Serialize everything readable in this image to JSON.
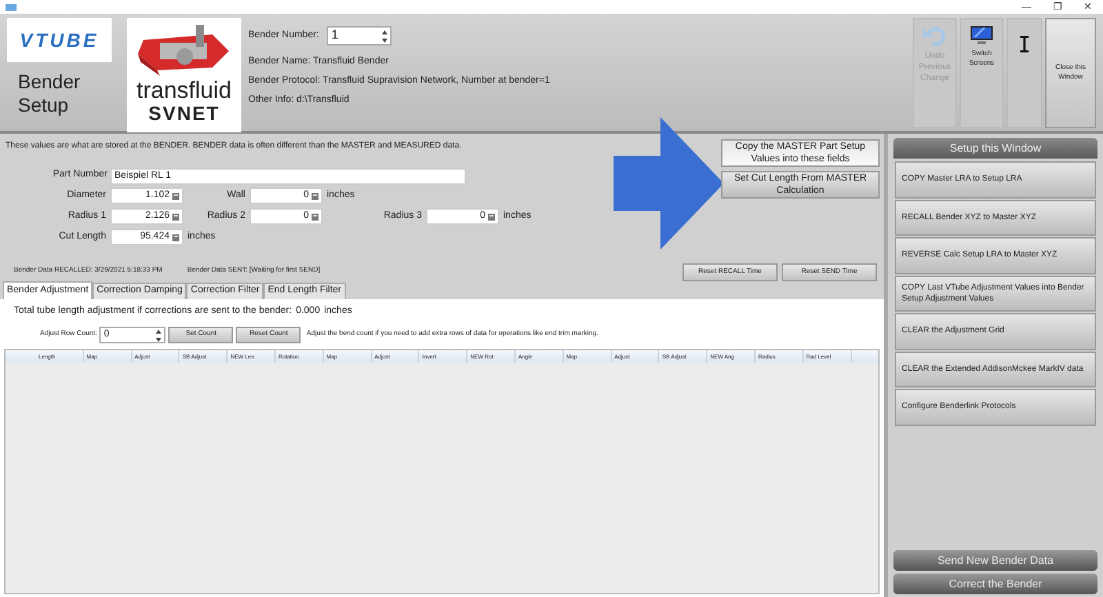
{
  "window": {
    "controls": [
      "—",
      "❐",
      "✕"
    ]
  },
  "header": {
    "logo": "VTUBE",
    "title": "Bender Setup",
    "brand": [
      "transfluid",
      "SVNET"
    ],
    "bender_number": {
      "label": "Bender Number:",
      "value": "1"
    },
    "info": [
      {
        "label": "Bender Name:",
        "value": "Transfluid Bender"
      },
      {
        "label": "Bender Protocol:",
        "value": "Transfluid Supravision Network, Number at bender=1"
      },
      {
        "label": "Other Info:",
        "value": "d:\\Transfluid"
      }
    ],
    "toolbar": [
      {
        "kind": "undo",
        "label": "Undo Previous Change",
        "disabled": true
      },
      {
        "kind": "screens",
        "label": "Switch Screens",
        "disabled": false
      },
      {
        "kind": "cursor",
        "disabled": false
      },
      {
        "kind": "close",
        "label": "Close this Window",
        "disabled": false
      }
    ]
  },
  "notice": "These values are what are stored at the BENDER.  BENDER data is often different than the MASTER and MEASURED data.",
  "part_number": {
    "label": "Part Number",
    "value": "Beispiel RL 1"
  },
  "fields": [
    [
      {
        "label": "Diameter",
        "value": "1.102"
      },
      {
        "label": "Wall",
        "value": "0",
        "unit": "inches"
      }
    ],
    [
      {
        "label": "Radius 1",
        "value": "2.126"
      },
      {
        "label": "Radius 2",
        "value": "0"
      },
      {
        "label": "Radius 3",
        "value": "0",
        "unit": "inches"
      }
    ],
    [
      {
        "label": "Cut Length",
        "value": "95.424",
        "unit": "inches"
      }
    ]
  ],
  "actions": [
    "Copy the MASTER Part Setup Values into these fields",
    "Set Cut Length From MASTER Calculation"
  ],
  "status": [
    "Bender Data RECALLED: 3/29/2021 5:18:33 PM",
    "Bender Data SENT: [Waiting for first SEND]"
  ],
  "reset_buttons": [
    "Reset RECALL Time",
    "Reset SEND Time"
  ],
  "tabs": [
    {
      "label": "Bender Adjustment",
      "selected": true
    },
    {
      "label": "Correction Damping",
      "selected": false
    },
    {
      "label": "Correction Filter",
      "selected": false
    },
    {
      "label": "End Length Filter",
      "selected": false
    }
  ],
  "total": {
    "label": "Total tube length adjustment if corrections are sent to the bender:",
    "value": "0.000",
    "unit": "inches"
  },
  "row_count": {
    "label": "Adjust Row Count:",
    "value": "0",
    "buttons": [
      "Set Count",
      "Reset Count"
    ],
    "hint": "Adjust the bend count if you need to add extra rows of data for operations like end trim marking."
  },
  "table": {
    "columns": [
      "Length",
      "Map",
      "Adjust",
      "SB Adjust",
      "NEW Len",
      "Rotation",
      "Map",
      "Adjust",
      "Invert",
      "NEW Rot",
      "Angle",
      "Map",
      "Adjust",
      "SB Adjust",
      "NEW Ang",
      "Radius",
      "Rad Level"
    ]
  },
  "sidebar": {
    "title": "Setup this Window",
    "items": [
      {
        "label": "COPY Master LRA to Setup LRA"
      },
      {
        "label": "RECALL Bender XYZ to Master XYZ"
      },
      {
        "label": "REVERSE Calc Setup LRA to Master XYZ"
      },
      {
        "label": "COPY Last VTube Adjustment Values into Bender Setup Adjustment Values"
      },
      {
        "label": "CLEAR the Adjustment Grid"
      },
      {
        "label": "CLEAR the Extended AddisonMckee MarkIV data"
      },
      {
        "label": "Configure Benderlink Protocols"
      }
    ],
    "footer": [
      "Send New Bender Data",
      "Correct the Bender"
    ]
  }
}
